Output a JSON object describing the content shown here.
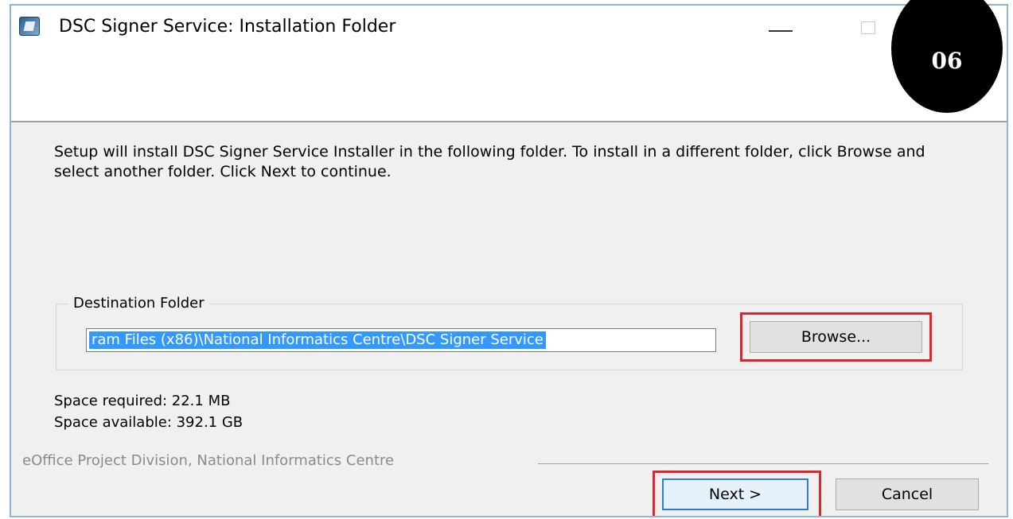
{
  "window": {
    "title": "DSC Signer Service: Installation Folder",
    "step_badge": "06"
  },
  "content": {
    "description": "Setup will install DSC Signer Service Installer in the following folder. To install in a different folder, click Browse and select another folder. Click Next to continue.",
    "destination_group_label": "Destination Folder",
    "destination_path": "ram Files (x86)\\National Informatics Centre\\DSC Signer Service",
    "browse_label": "Browse...",
    "space_required": "Space required: 22.1 MB",
    "space_available": "Space available: 392.1 GB"
  },
  "footer": {
    "branding": "eOffice Project Division, National Informatics Centre",
    "next_label": "Next >",
    "cancel_label": "Cancel"
  },
  "colors": {
    "highlight": "#d9272e",
    "selection": "#3399ff",
    "window_border": "#8fb5d6"
  },
  "icons": {
    "app_icon": "installer-icon",
    "minimize": "minimize-icon",
    "maximize": "maximize-icon"
  }
}
